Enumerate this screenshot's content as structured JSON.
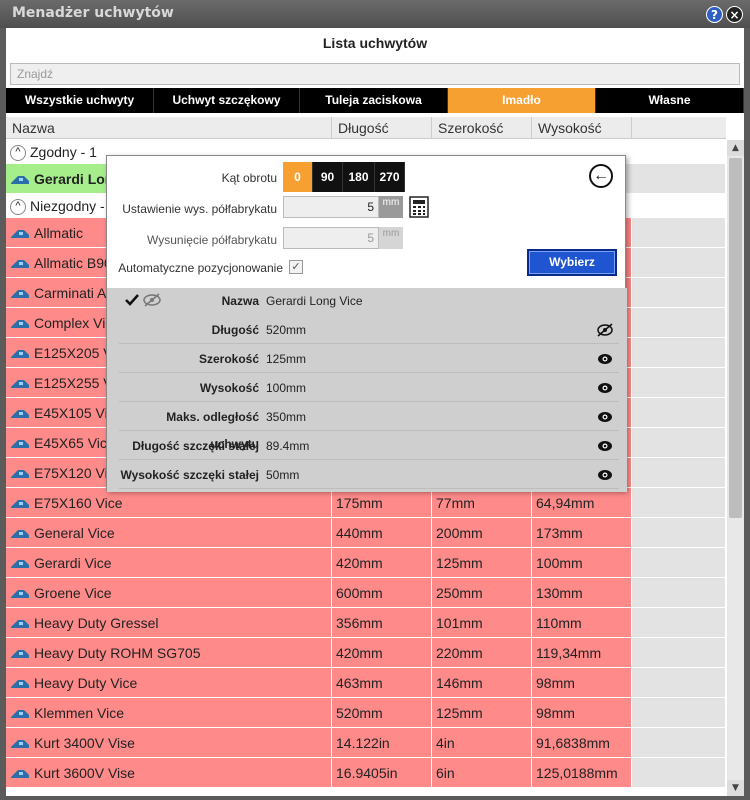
{
  "window": {
    "title": "Menadżer uchwytów",
    "help": "?",
    "close": "×"
  },
  "list_title": "Lista uchwytów",
  "search": {
    "placeholder": "Znajdź"
  },
  "tabs": [
    "Wszystkie uchwyty",
    "Uchwyt szczękowy",
    "Tuleja zaciskowa",
    "Imadło",
    "Własne"
  ],
  "active_tab": "Imadło",
  "columns": [
    "Nazwa",
    "Długość",
    "Szerokość",
    "Wysokość"
  ],
  "groups": {
    "match": "Zgodny - 1",
    "mismatch": "Niezgodny - 25"
  },
  "matched_row": {
    "name": "Gerardi Long Vice"
  },
  "rows": [
    {
      "name": "Allmatic",
      "len": "",
      "wid": "",
      "hei": ""
    },
    {
      "name": "Allmatic B90",
      "len": "",
      "wid": "",
      "hei": ""
    },
    {
      "name": "Carminati A",
      "len": "",
      "wid": "",
      "hei": ""
    },
    {
      "name": "Complex Vice",
      "len": "",
      "wid": "",
      "hei": ""
    },
    {
      "name": "E125X205 Vice",
      "len": "",
      "wid": "",
      "hei": ""
    },
    {
      "name": "E125X255 Vice",
      "len": "",
      "wid": "",
      "hei": ""
    },
    {
      "name": "E45X105 Vice",
      "len": "",
      "wid": "",
      "hei": ""
    },
    {
      "name": "E45X65 Vice",
      "len": "",
      "wid": "",
      "hei": ""
    },
    {
      "name": "E75X120 Vice",
      "len": "",
      "wid": "",
      "hei": ""
    },
    {
      "name": "E75X160 Vice",
      "len": "175mm",
      "wid": "77mm",
      "hei": "64,94mm"
    },
    {
      "name": "General Vice",
      "len": "440mm",
      "wid": "200mm",
      "hei": "173mm"
    },
    {
      "name": "Gerardi Vice",
      "len": "420mm",
      "wid": "125mm",
      "hei": "100mm"
    },
    {
      "name": "Groene Vice",
      "len": "600mm",
      "wid": "250mm",
      "hei": "130mm"
    },
    {
      "name": "Heavy Duty Gressel",
      "len": "356mm",
      "wid": "101mm",
      "hei": "110mm"
    },
    {
      "name": "Heavy Duty ROHM SG705",
      "len": "420mm",
      "wid": "220mm",
      "hei": "119,34mm"
    },
    {
      "name": "Heavy Duty Vice",
      "len": "463mm",
      "wid": "146mm",
      "hei": "98mm"
    },
    {
      "name": "Klemmen Vice",
      "len": "520mm",
      "wid": "125mm",
      "hei": "98mm"
    },
    {
      "name": "Kurt 3400V Vise",
      "len": "14.122in",
      "wid": "4in",
      "hei": "91,6838mm"
    },
    {
      "name": "Kurt 3600V Vise",
      "len": "16.9405in",
      "wid": "6in",
      "hei": "125,0188mm"
    }
  ],
  "popup": {
    "rotation_label": "Kąt obrotu",
    "rotation_options": [
      "0",
      "90",
      "180",
      "270"
    ],
    "rotation_selected": "0",
    "stock_setting_label": "Ustawienie wys. półfabrykatu",
    "stock_setting_value": "5",
    "stock_setting_unit": "mm",
    "stock_offset_label": "Wysunięcie półfabrykatu",
    "stock_offset_value": "5",
    "stock_offset_unit": "mm",
    "auto_pos_label": "Automatyczne pozycjonowanie",
    "auto_pos_checked": "✓",
    "select_button": "Wybierz",
    "props": [
      {
        "key": "Nazwa",
        "value": "Gerardi Long Vice"
      },
      {
        "key": "Długość",
        "value": "520mm"
      },
      {
        "key": "Szerokość",
        "value": "125mm"
      },
      {
        "key": "Wysokość",
        "value": "100mm"
      },
      {
        "key": "Maks. odległość uchwytu",
        "value": "350mm"
      },
      {
        "key": "Długość szczęki stałej",
        "value": "89.4mm"
      },
      {
        "key": "Wysokość szczęki stałej",
        "value": "50mm"
      }
    ]
  },
  "colors": {
    "active_tab": "#f5a030",
    "mismatch_row": "#ff8a8a",
    "match_row": "#a6ee8c",
    "select_button": "#1f55d0"
  }
}
